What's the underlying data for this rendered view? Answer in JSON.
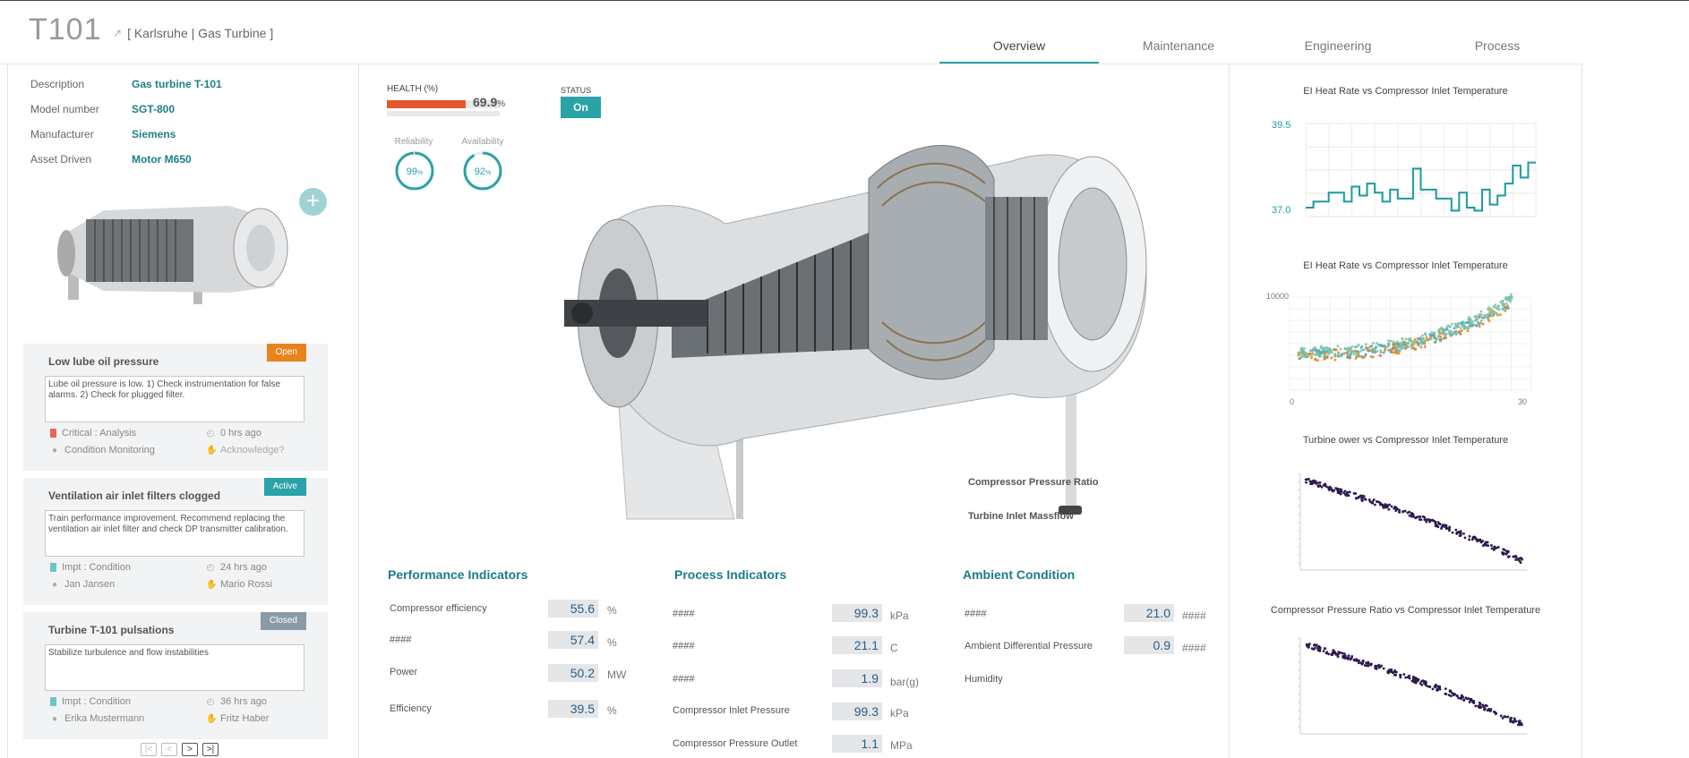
{
  "header": {
    "asset_id": "T101",
    "location": "[ Karlsruhe | Gas Turbine ]",
    "tabs": [
      {
        "label": "Overview",
        "active": true
      },
      {
        "label": "Maintenance",
        "active": false
      },
      {
        "label": "Engineering",
        "active": false
      },
      {
        "label": "Process",
        "active": false
      }
    ]
  },
  "asset_info": [
    {
      "label": "Description",
      "value": "Gas turbine T-101"
    },
    {
      "label": "Model number",
      "value": "SGT-800"
    },
    {
      "label": "Manufacturer",
      "value": "Siemens"
    },
    {
      "label": "Asset Driven",
      "value": "Motor M650"
    }
  ],
  "notifications": [
    {
      "title": "Low lube oil pressure",
      "status": "Open",
      "status_color": "#e8841e",
      "text": "Lube oil pressure is low. 1) Check instrumentation for false alarms. 2) Check for plugged filter.",
      "priority": "Critical : Analysis",
      "priority_color": "#e06b5a",
      "age": "0 hrs ago",
      "owner": "Condition Monitoring",
      "ack": "Acknowledge?",
      "ack_icon": "thumbs-up-icon",
      "ack_active": false
    },
    {
      "title": "Ventilation air inlet filters clogged",
      "status": "Active",
      "status_color": "#2aa3a8",
      "text": "Train performance improvement. Recommend replacing the ventilation air inlet filter and check DP transmitter calibration.",
      "priority": "Impt : Condition",
      "priority_color": "#6cc5c8",
      "age": "24 hrs ago",
      "owner": "Jan Jansen",
      "ack": "Mario Rossi",
      "ack_icon": "thumbs-up-icon",
      "ack_active": true
    },
    {
      "title": "Turbine T-101 pulsations",
      "status": "Closed",
      "status_color": "#8a9aa6",
      "text": "Stabilize turbulence and flow instabilities",
      "priority": "Impt : Condition",
      "priority_color": "#6cc5c8",
      "age": "36 hrs ago",
      "owner": "Erika Mustermann",
      "ack": "Fritz Haber",
      "ack_icon": "thumbs-up-icon",
      "ack_active": true
    }
  ],
  "pager": [
    "|<",
    "<",
    ">",
    ">|"
  ],
  "health": {
    "label": "HEALTH (%)",
    "value": "69.9",
    "unit": "%",
    "fraction": 0.699,
    "status_label": "STATUS",
    "status_value": "On",
    "reliability_label": "Reliability",
    "reliability_value": "99",
    "reliability_fraction": 0.99,
    "availability_label": "Availability",
    "availability_value": "92",
    "availability_fraction": 0.92,
    "gauge_unit": "%"
  },
  "annotations": {
    "compressor_pressure_ratio": "Compressor Pressure Ratio",
    "turbine_inlet_massflow": "Turbine Inlet Massflow"
  },
  "performance": {
    "title": "Performance Indicators",
    "rows": [
      {
        "label": "Compressor efficiency",
        "value": "55.6",
        "unit": "%"
      },
      {
        "label": "####",
        "value": "57.4",
        "unit": "%"
      },
      {
        "label": "Power",
        "value": "50.2",
        "unit": "MW"
      },
      {
        "label": "Efficiency",
        "value": "39.5",
        "unit": "%"
      }
    ]
  },
  "process": {
    "title": "Process Indicators",
    "rows": [
      {
        "label": "####",
        "value": "99.3",
        "unit": "kPa"
      },
      {
        "label": "####",
        "value": "21.1",
        "unit": "C"
      },
      {
        "label": "####",
        "value": "1.9",
        "unit": "bar(g)"
      },
      {
        "label": "Compressor Inlet Pressure",
        "value": "99.3",
        "unit": "kPa"
      },
      {
        "label": "Compressor Pressure Outlet",
        "value": "1.1",
        "unit": "MPa"
      }
    ]
  },
  "ambient": {
    "title": "Ambient Condition",
    "rows": [
      {
        "label": "####",
        "value": "21.0",
        "unit": "####"
      },
      {
        "label": "Ambient Differential Pressure",
        "value": "0.9",
        "unit": "####"
      },
      {
        "label": "Humidity",
        "value": "",
        "unit": ""
      }
    ]
  },
  "chart_data": [
    {
      "type": "line",
      "title": "EI Heat Rate vs Compressor Inlet Temperature",
      "y_ticks": [
        "39.5",
        "37.0"
      ],
      "ylim": [
        37.0,
        39.5
      ],
      "color": "#1a9ba0",
      "values": [
        37.0,
        37.2,
        37.2,
        37.5,
        37.5,
        37.2,
        37.7,
        37.4,
        37.8,
        37.5,
        37.2,
        37.6,
        37.3,
        37.3,
        38.3,
        37.6,
        37.6,
        37.3,
        37.3,
        36.9,
        37.5,
        37.0,
        36.9,
        37.6,
        37.1,
        37.4,
        37.8,
        38.4,
        38.0,
        38.5
      ]
    },
    {
      "type": "scatter",
      "title": "EI Heat Rate vs Compressor Inlet Temperature",
      "y_ticks": [
        "10000"
      ],
      "x_ticks": [
        "0",
        "30"
      ],
      "xlim": [
        0,
        30
      ],
      "series_colors": [
        "#e8841e",
        "#4fa8c8",
        "#7bc8a0"
      ]
    },
    {
      "type": "scatter",
      "title": "Turbine ower vs Compressor Inlet Temperature",
      "color": "#2d1b4e"
    },
    {
      "type": "scatter",
      "title": "Compressor Pressure Ratio vs Compressor Inlet Temperature",
      "color": "#2d1b4e"
    }
  ]
}
